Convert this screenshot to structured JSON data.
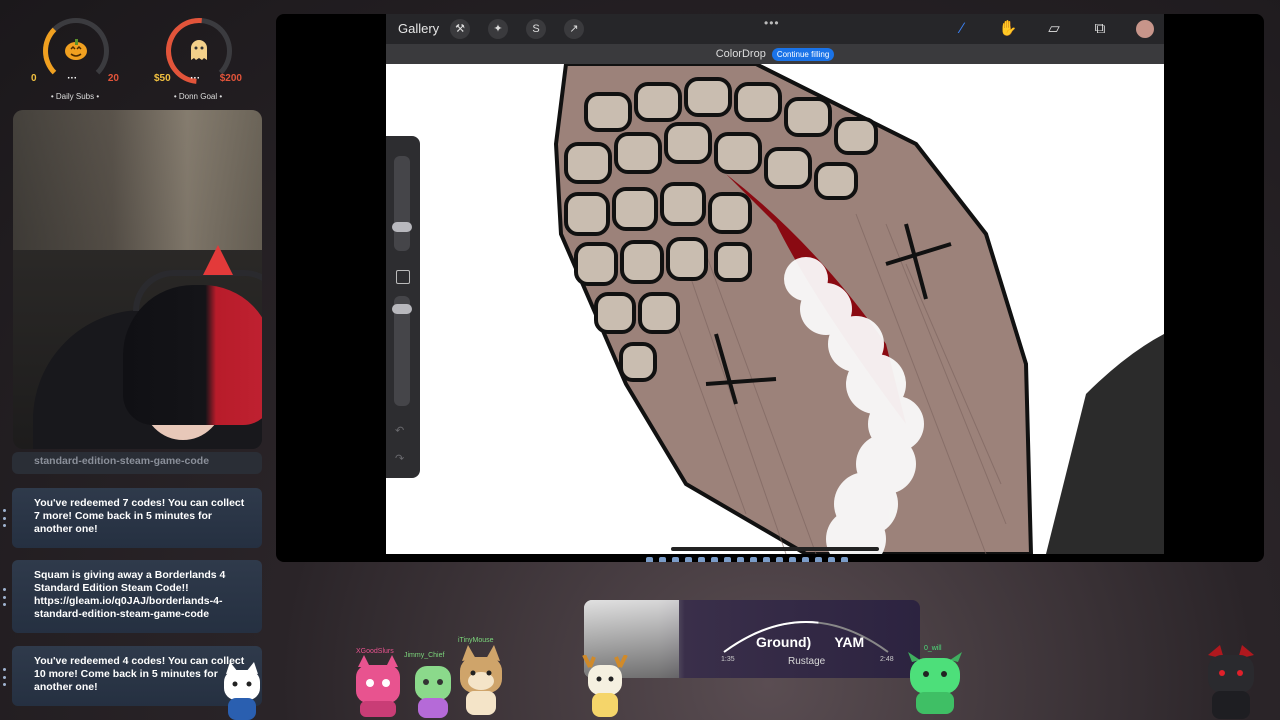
{
  "goals": {
    "daily_subs": {
      "start": "0",
      "dots": "···",
      "end": "20",
      "name": "• Daily Subs •",
      "accent": "#f0a020"
    },
    "donation": {
      "start": "$50",
      "dots": "···",
      "end": "$200",
      "name": "• Donn Goal •",
      "accent": "#e2543a"
    }
  },
  "chat": {
    "faded_line": "standard-edition-steam-game-code",
    "cards": [
      {
        "text": "You've redeemed 7 codes! You can collect 7 more! Come back in 5 minutes for another one!"
      },
      {
        "text": "Squam is giving away a Borderlands 4 Standard Edition Steam Code!!\nhttps://gleam.io/q0JAJ/borderlands-4-standard-edition-steam-game-code"
      },
      {
        "text": "You've redeemed 4 codes! You can collect 10 more! Come back in 5 minutes for another one!"
      }
    ]
  },
  "procreate": {
    "gallery_label": "Gallery",
    "left_tools": [
      "wrench-icon",
      "magic-wand-icon",
      "selection-icon",
      "transform-arrow-icon"
    ],
    "right_tools": [
      "brush-icon",
      "smudge-icon",
      "eraser-icon",
      "layers-icon"
    ],
    "more_label": "•••",
    "colordrop_label": "ColorDrop",
    "continue_label": "Continue filling",
    "color_swatch": "#c7958a"
  },
  "player": {
    "song": "Ground)",
    "song_tail": "YAM",
    "artist": "Rustage",
    "elapsed": "1:35",
    "total": "2:48",
    "progress": 0.57
  },
  "avatars": [
    {
      "name": "XGoodSlurs",
      "color": "#e8538f"
    },
    {
      "name": "Jimmy_Chief",
      "color": "#7cd67c"
    },
    {
      "name": "iTinyMouse",
      "color": "#cfa46a"
    },
    {
      "name": "0_will",
      "color": "#4ddf7a"
    }
  ]
}
